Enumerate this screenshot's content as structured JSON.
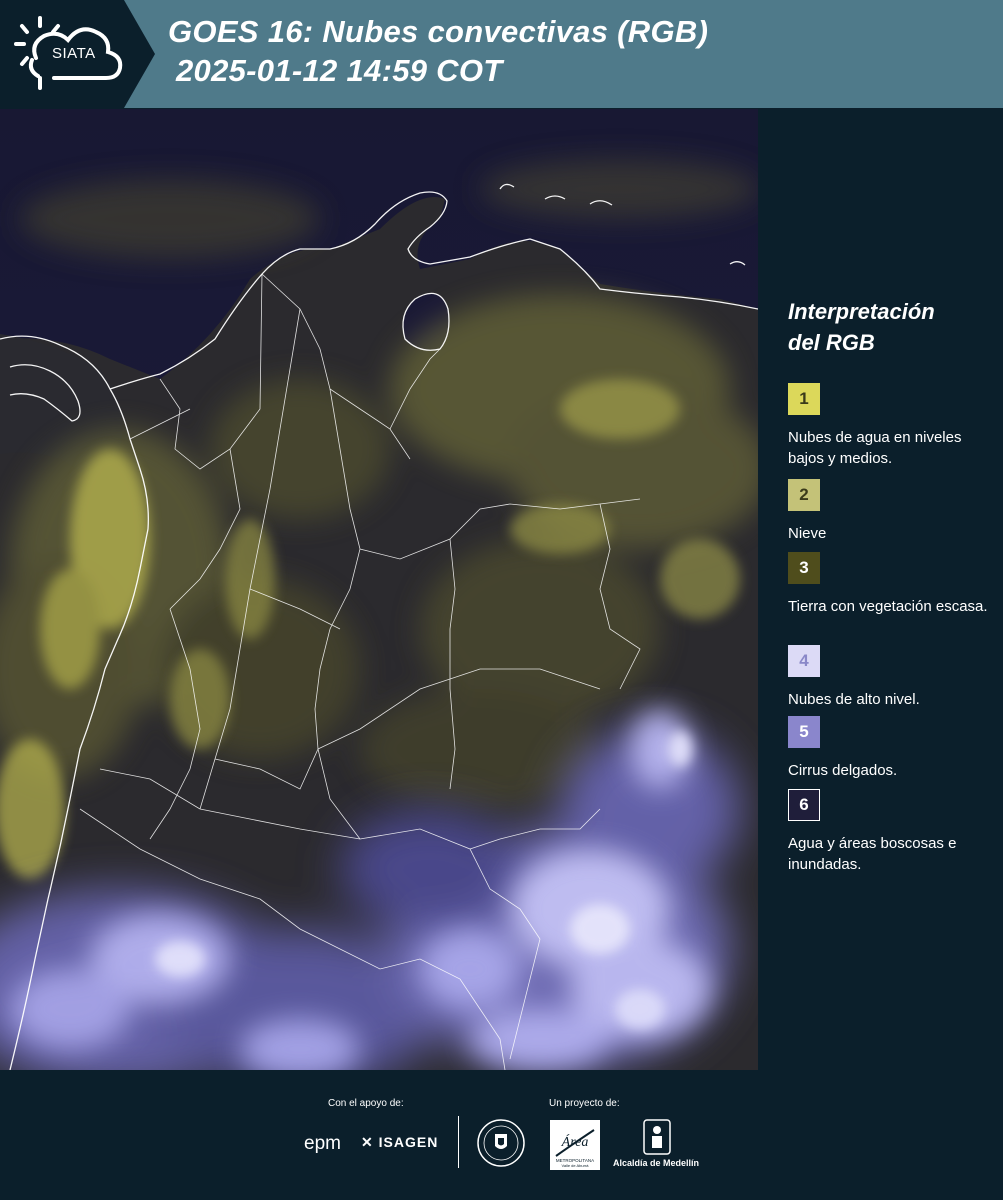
{
  "header": {
    "logo_text": "SIATA",
    "title_line1": "GOES 16: Nubes convectivas (RGB)",
    "title_line2": "2025-01-12 14:59 COT"
  },
  "legend": {
    "title_line1": "Interpretación",
    "title_line2": "del RGB",
    "items": [
      {
        "number": "1",
        "label": "Nubes de agua en niveles bajos y medios.",
        "color": "#dcd85a"
      },
      {
        "number": "2",
        "label": "Nieve",
        "color": "#c4c278"
      },
      {
        "number": "3",
        "label": "Tierra con vegetación escasa.",
        "color": "#4f4d1c"
      },
      {
        "number": "4",
        "label": "Nubes de alto nivel.",
        "color": "#dcdaf6"
      },
      {
        "number": "5",
        "label": "Cirrus delgados.",
        "color": "#8a86cc"
      },
      {
        "number": "6",
        "label": "Agua y áreas boscosas e inundadas.",
        "color": "#1f1e3a"
      }
    ]
  },
  "footer": {
    "support_label": "Con el apoyo de:",
    "project_label": "Un proyecto de:",
    "sponsors": [
      "epm",
      "ISAGEN"
    ],
    "partners": [
      "Alcaldía de Medellín"
    ],
    "seal_text": "MEDELLÍN",
    "amva_text": "Área",
    "amva_subtext": "METROPOLITANA",
    "amva_subtext2": "Valle de Aburrá"
  }
}
